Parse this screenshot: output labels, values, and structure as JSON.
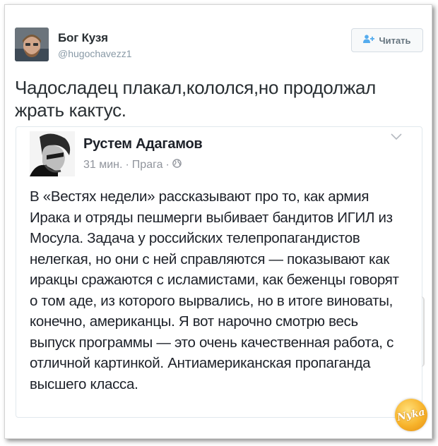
{
  "tweet": {
    "author_name": "Бог Кузя",
    "author_handle": "@hugochavezz1",
    "follow_label": "Читать",
    "text": "Чадосладец плакал,кололся,но продолжал жрать кактус."
  },
  "quoted_post": {
    "author_name": "Рустем Адагамов",
    "time": "31 мин.",
    "location": "Прага",
    "separator": "·",
    "body": "В «Вестях недели» рассказывают про то, как армия Ирака и отряды пешмерги выбивает бандитов ИГИЛ из Мосула. Задача у российских телепропагандистов нелегкая, но они с ней справляются — показывают как иракцы сражаются с исламистами, как беженцы говорят о том аде, из которого вырвались, но в итоге виноваты, конечно, американцы. Я вот нарочно смотрю весь выпуск программы — это очень качественная работа, с отличной картинкой. Антиамериканская пропаганда высшего класса."
  },
  "watermark": {
    "text": "Nyka"
  },
  "icons": {
    "follow": "person-plus-icon",
    "audience": "globe-icon",
    "menu": "chevron-down-icon"
  },
  "colors": {
    "muted": "#8899a6",
    "text": "#292f33",
    "border": "#e1e8ed",
    "watermark": "#f7b32b"
  }
}
